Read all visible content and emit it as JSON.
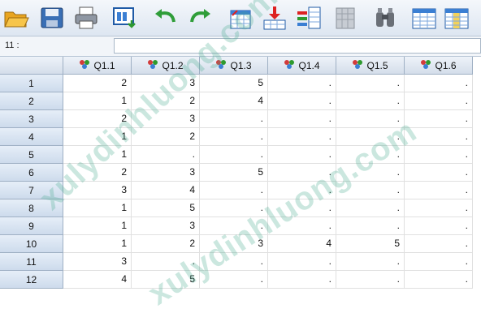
{
  "toolbar": {
    "icons": [
      "open-folder-icon",
      "save-icon",
      "print-icon",
      "recall-dialog-icon",
      "undo-icon",
      "redo-icon",
      "goto-case-icon",
      "goto-variable-icon",
      "variables-icon",
      "run-descriptives-icon",
      "find-icon",
      "insert-cases-icon",
      "insert-variable-icon"
    ]
  },
  "cellbar": {
    "ref": "11 :",
    "value": ""
  },
  "columns": [
    "Q1.1",
    "Q1.2",
    "Q1.3",
    "Q1.4",
    "Q1.5",
    "Q1.6"
  ],
  "rows": [
    {
      "n": "1",
      "v": [
        "2",
        "3",
        "5",
        ".",
        ".",
        "."
      ]
    },
    {
      "n": "2",
      "v": [
        "1",
        "2",
        "4",
        ".",
        ".",
        "."
      ]
    },
    {
      "n": "3",
      "v": [
        "2",
        "3",
        ".",
        ".",
        ".",
        "."
      ]
    },
    {
      "n": "4",
      "v": [
        "1",
        "2",
        ".",
        ".",
        ".",
        "."
      ]
    },
    {
      "n": "5",
      "v": [
        "1",
        ".",
        ".",
        ".",
        ".",
        "."
      ]
    },
    {
      "n": "6",
      "v": [
        "2",
        "3",
        "5",
        ".",
        ".",
        "."
      ]
    },
    {
      "n": "7",
      "v": [
        "3",
        "4",
        ".",
        ".",
        ".",
        "."
      ]
    },
    {
      "n": "8",
      "v": [
        "1",
        "5",
        ".",
        ".",
        ".",
        "."
      ]
    },
    {
      "n": "9",
      "v": [
        "1",
        "3",
        ".",
        ".",
        ".",
        "."
      ]
    },
    {
      "n": "10",
      "v": [
        "1",
        "2",
        "3",
        "4",
        "5",
        "."
      ]
    },
    {
      "n": "11",
      "v": [
        "3",
        ".",
        ".",
        ".",
        ".",
        "."
      ]
    },
    {
      "n": "12",
      "v": [
        "4",
        "5",
        ".",
        ".",
        ".",
        "."
      ]
    }
  ],
  "watermark": "xulydinhluong.com",
  "colors": {
    "header_bg": "#d4deea",
    "watermark": "#46aa8c"
  }
}
